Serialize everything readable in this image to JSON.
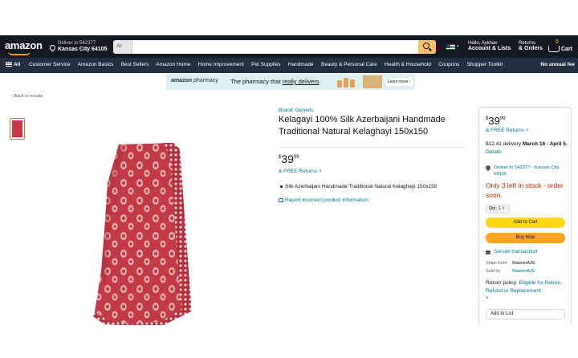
{
  "header": {
    "logo": "amazon",
    "deliver_line1": "Deliver to 542377",
    "deliver_line2": "Kansas City 64105",
    "search_category": "All",
    "search_placeholder": "",
    "account_line1": "Hello, Aykhan",
    "account_line2": "Account & Lists",
    "orders_line1": "Returns",
    "orders_line2": "& Orders",
    "cart_count": "0",
    "cart_label": "Cart"
  },
  "subnav": {
    "all": "All",
    "items": [
      "Customer Service",
      "Amazon Basics",
      "Best Sellers",
      "Amazon Home",
      "Home Improvement",
      "Pet Supplies",
      "Handmade",
      "Beauty & Personal Care",
      "Health & Household",
      "Coupons",
      "Shopper Toolkit"
    ],
    "right": "No annual fee"
  },
  "banner": {
    "brand_a": "amazon",
    "brand_b": "pharmacy",
    "msg_a": "The pharmacy that ",
    "msg_b": "really delivers",
    "cta": "Learn more ›"
  },
  "back_link": "‹ Back to results",
  "product": {
    "brand": "Brand: Generic",
    "title": "Kelagayi 100% Silk Azerbaijani Handmade Traditional Natural Kelaghayi 150x150",
    "price_symbol": "$",
    "price_whole": "39",
    "price_fraction": "99",
    "free_returns": "& FREE Returns ˅",
    "bullet": "Silk Azerbaijani Handmade Traditional Natural Kelaghayi 150x150",
    "report": "Report incorrect product information."
  },
  "buybox": {
    "price_symbol": "$",
    "price_whole": "39",
    "price_fraction": "99",
    "free_returns": "& FREE Returns ˅",
    "delivery_text": "$12.41 delivery ",
    "delivery_date": "March 16 - April 5.",
    "delivery_link": "Details",
    "deliver_to": "Deliver to 542377 - Kansas City 64105",
    "stock": "Only 3 left in stock - order soon.",
    "qty": "Qty: 1 ˅",
    "add_to_cart": "Add to Cart",
    "buy_now": "Buy Now",
    "secure": "Secure transaction",
    "ships_from_label": "Ships from",
    "ships_from_value": "MadeinAZE",
    "sold_by_label": "Sold by",
    "sold_by_value": "MadeinAZE",
    "return_label": "Return policy: ",
    "return_link": "Eligible for Return, Refund or Replacement.",
    "return_caret": "˅",
    "add_to_list": "Add to List"
  },
  "colors": {
    "nav": "#131921",
    "subnav": "#232f3e",
    "accent": "#ff9900",
    "link": "#007185",
    "stock": "#b12704",
    "cart_button": "#ffd814",
    "buy_button": "#ffa41c",
    "scarf": "#c23a47"
  }
}
